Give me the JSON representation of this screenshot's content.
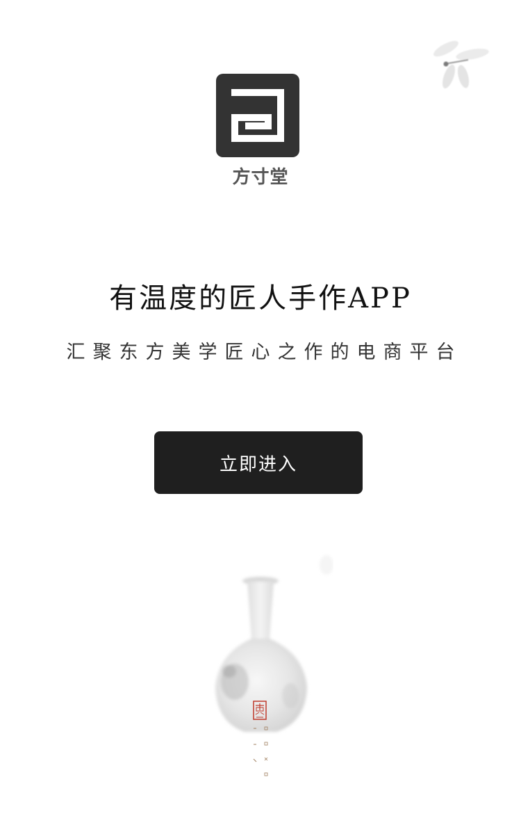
{
  "brand": {
    "name": "方寸堂",
    "logo_icon": "square-spiral-logo-icon",
    "logo_color": "#333333"
  },
  "headline": "有温度的匠人手作APP",
  "subline": "汇聚东方美学匠心之作的电商平台",
  "enter_button": {
    "label": "立即进入",
    "background": "#1f1f1f",
    "text_color": "#ffffff"
  },
  "decorations": {
    "top_right": "dragonfly-icon",
    "bottom": "porcelain-vase-icon",
    "seal": "red-seal-icon",
    "seal_color": "#c0392b"
  }
}
